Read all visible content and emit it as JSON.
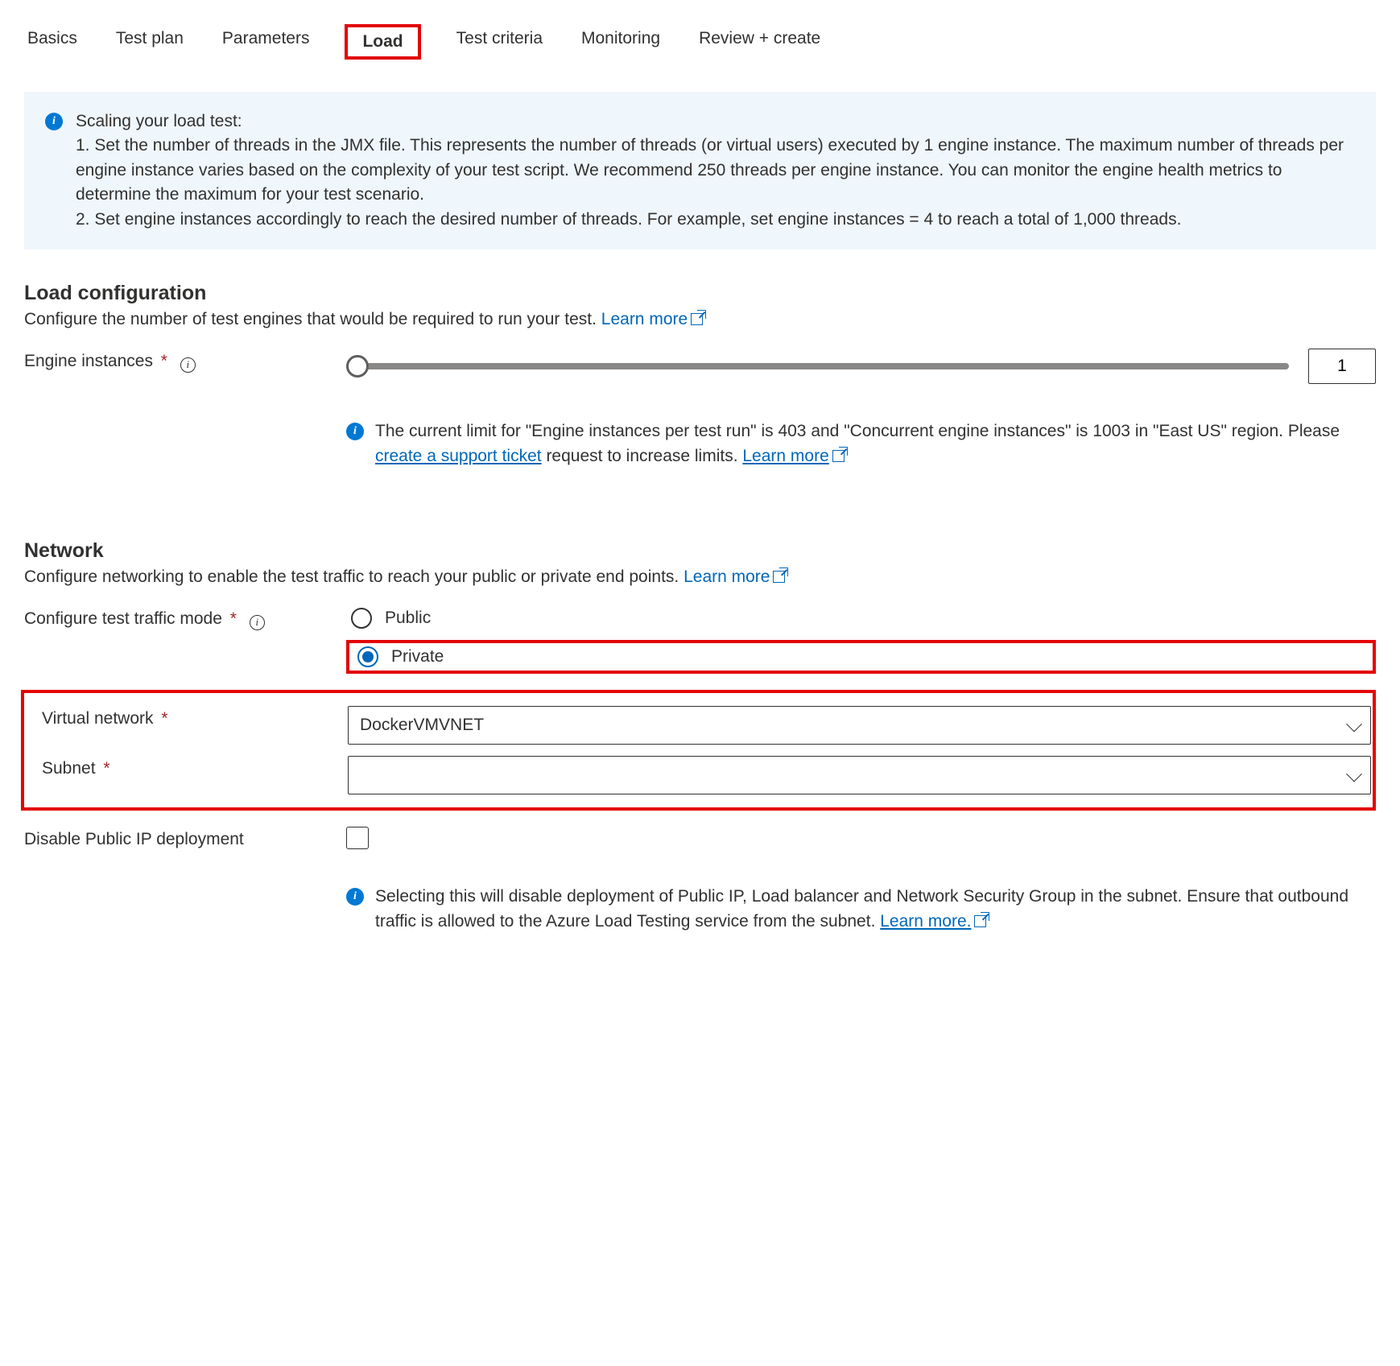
{
  "tabs": {
    "basics": "Basics",
    "test_plan": "Test plan",
    "parameters": "Parameters",
    "load": "Load",
    "criteria": "Test criteria",
    "monitoring": "Monitoring",
    "review": "Review + create"
  },
  "scaling_info": {
    "title": "Scaling your load test:",
    "line1": "1. Set the number of threads in the JMX file. This represents the number of threads (or virtual users) executed by 1 engine instance. The maximum number of threads per engine instance varies based on the complexity of your test script. We recommend 250 threads per engine instance. You can monitor the engine health metrics to determine the maximum for your test scenario.",
    "line2": "2. Set engine instances accordingly to reach the desired number of threads. For example, set engine instances = 4 to reach a total of 1,000 threads."
  },
  "load_cfg": {
    "title": "Load configuration",
    "desc": "Configure the number of test engines that would be required to run your test.",
    "learn_more": "Learn more",
    "engines_label": "Engine instances",
    "engines_value": "1",
    "limit_a": "The current limit for \"Engine instances per test run\" is 403 and \"Concurrent engine instances\" is 1003 in \"East US\" region. Please ",
    "limit_link1": "create a support ticket",
    "limit_b": " request to increase limits. ",
    "limit_link2": "Learn more"
  },
  "network": {
    "title": "Network",
    "desc": "Configure networking to enable the test traffic to reach your public or private end points.",
    "learn_more": "Learn more",
    "mode_label": "Configure test traffic mode",
    "mode_public": "Public",
    "mode_private": "Private",
    "vnet_label": "Virtual network",
    "vnet_value": "DockerVMVNET",
    "subnet_label": "Subnet",
    "subnet_value": "",
    "disable_ip_label": "Disable Public IP deployment",
    "disable_ip_info": "Selecting this will disable deployment of Public IP, Load balancer and Network Security Group in the subnet. Ensure that outbound traffic is allowed to the Azure Load Testing service from the subnet. ",
    "disable_ip_link": "Learn more."
  }
}
